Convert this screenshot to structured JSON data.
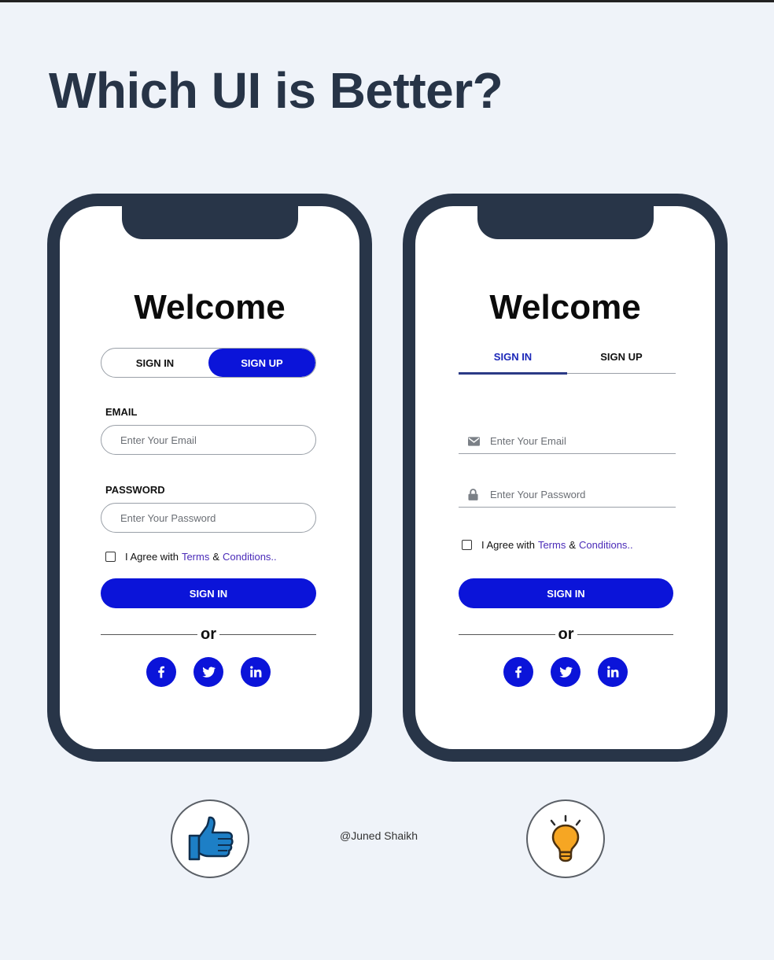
{
  "heading": "Which UI is Better?",
  "credit": "@Juned Shaikh",
  "colors": {
    "accent": "#0b14d9",
    "frame": "#283548",
    "link": "#4a2bb8",
    "background": "#eff3f9"
  },
  "left_ui": {
    "welcome": "Welcome",
    "toggle": {
      "signin_label": "SIGN IN",
      "signup_label": "SIGN UP",
      "active": "SIGN UP"
    },
    "email_label": "EMAIL",
    "email_placeholder": "Enter Your Email",
    "password_label": "PASSWORD",
    "password_placeholder": "Enter Your Password",
    "agree": {
      "prefix": "I Agree with",
      "terms": "Terms",
      "amp": "&",
      "conditions": "Conditions.."
    },
    "submit_label": "SIGN IN",
    "or_label": "or",
    "social": [
      "facebook-icon",
      "twitter-icon",
      "linkedin-icon"
    ]
  },
  "right_ui": {
    "welcome": "Welcome",
    "tabs": {
      "signin_label": "SIGN IN",
      "signup_label": "SIGN UP",
      "active": "SIGN IN"
    },
    "email_placeholder": "Enter Your Email",
    "password_placeholder": "Enter Your Password",
    "agree": {
      "prefix": "I Agree with",
      "terms": "Terms",
      "amp": "&",
      "conditions": "Conditions.."
    },
    "submit_label": "SIGN IN",
    "or_label": "or",
    "social": [
      "facebook-icon",
      "twitter-icon",
      "linkedin-icon"
    ]
  },
  "badges": {
    "left_icon": "thumbs-up-icon",
    "right_icon": "lightbulb-icon"
  }
}
